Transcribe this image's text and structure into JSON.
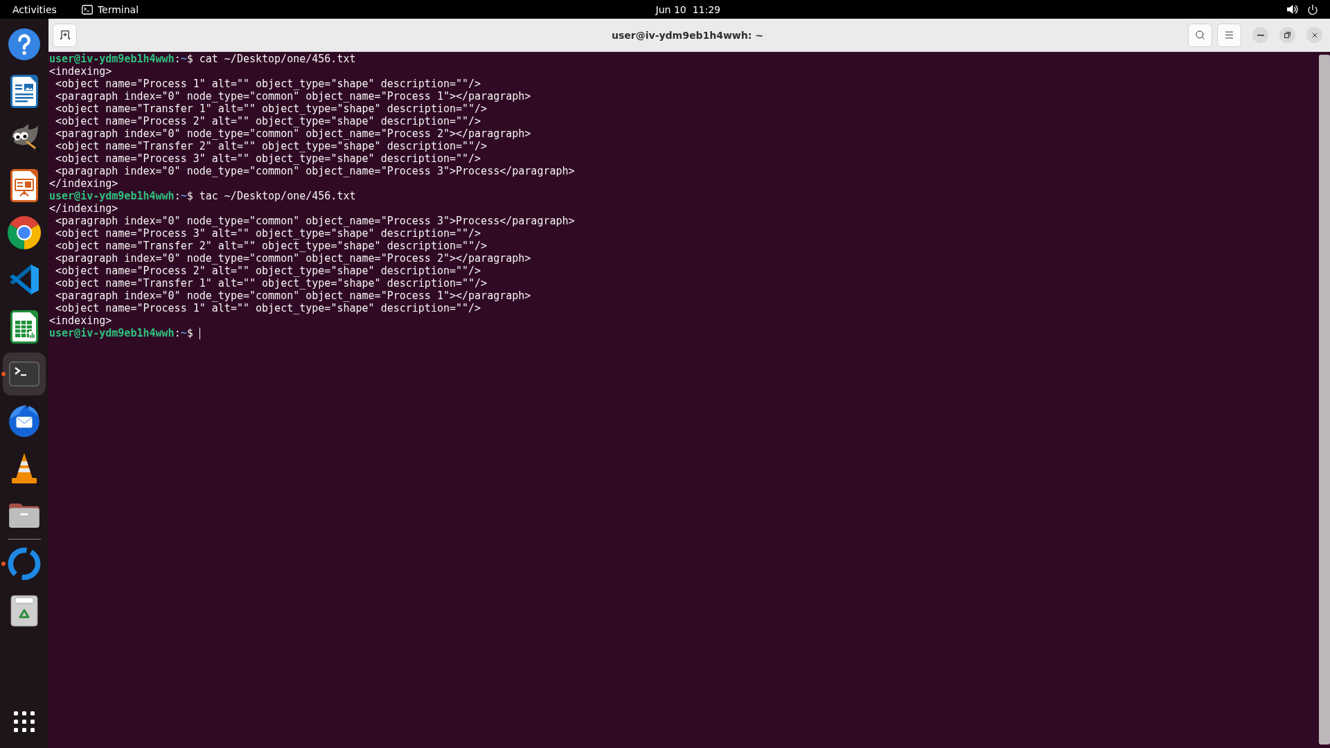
{
  "top_bar": {
    "activities": "Activities",
    "app_name": "Terminal",
    "clock": "Jun 10  11:29"
  },
  "dock": {
    "pinned": [
      {
        "running": false,
        "selected": false
      },
      {
        "running": false,
        "selected": false
      },
      {
        "running": false,
        "selected": false
      },
      {
        "running": false,
        "selected": false
      },
      {
        "running": false,
        "selected": false
      },
      {
        "running": false,
        "selected": false
      },
      {
        "running": false,
        "selected": false
      },
      {
        "running": true,
        "selected": true
      },
      {
        "running": false,
        "selected": false
      },
      {
        "running": false,
        "selected": false
      },
      {
        "running": false,
        "selected": false
      }
    ],
    "others": [
      {
        "running": true,
        "selected": false
      },
      {
        "running": false,
        "selected": false
      }
    ]
  },
  "window": {
    "title": "user@iv-ydm9eb1h4wwh: ~"
  },
  "terminal": {
    "lines": [
      {
        "kind": "prompt",
        "user_host": "user@iv-ydm9eb1h4wwh",
        "separator": ":",
        "path": "~",
        "symbol": "$",
        "command": "cat ~/Desktop/one/456.txt",
        "cursor": false
      },
      {
        "kind": "output",
        "text": "<indexing>"
      },
      {
        "kind": "output",
        "text": " <object name=\"Process 1\" alt=\"\" object_type=\"shape\" description=\"\"/>"
      },
      {
        "kind": "output",
        "text": " <paragraph index=\"0\" node_type=\"common\" object_name=\"Process 1\"></paragraph>"
      },
      {
        "kind": "output",
        "text": " <object name=\"Transfer 1\" alt=\"\" object_type=\"shape\" description=\"\"/>"
      },
      {
        "kind": "output",
        "text": " <object name=\"Process 2\" alt=\"\" object_type=\"shape\" description=\"\"/>"
      },
      {
        "kind": "output",
        "text": " <paragraph index=\"0\" node_type=\"common\" object_name=\"Process 2\"></paragraph>"
      },
      {
        "kind": "output",
        "text": " <object name=\"Transfer 2\" alt=\"\" object_type=\"shape\" description=\"\"/>"
      },
      {
        "kind": "output",
        "text": " <object name=\"Process 3\" alt=\"\" object_type=\"shape\" description=\"\"/>"
      },
      {
        "kind": "output",
        "text": " <paragraph index=\"0\" node_type=\"common\" object_name=\"Process 3\">Process</paragraph>"
      },
      {
        "kind": "output",
        "text": "</indexing>"
      },
      {
        "kind": "prompt",
        "user_host": "user@iv-ydm9eb1h4wwh",
        "separator": ":",
        "path": "~",
        "symbol": "$",
        "command": "tac ~/Desktop/one/456.txt",
        "cursor": false
      },
      {
        "kind": "output",
        "text": "</indexing>"
      },
      {
        "kind": "output",
        "text": " <paragraph index=\"0\" node_type=\"common\" object_name=\"Process 3\">Process</paragraph>"
      },
      {
        "kind": "output",
        "text": " <object name=\"Process 3\" alt=\"\" object_type=\"shape\" description=\"\"/>"
      },
      {
        "kind": "output",
        "text": " <object name=\"Transfer 2\" alt=\"\" object_type=\"shape\" description=\"\"/>"
      },
      {
        "kind": "output",
        "text": " <paragraph index=\"0\" node_type=\"common\" object_name=\"Process 2\"></paragraph>"
      },
      {
        "kind": "output",
        "text": " <object name=\"Process 2\" alt=\"\" object_type=\"shape\" description=\"\"/>"
      },
      {
        "kind": "output",
        "text": " <object name=\"Transfer 1\" alt=\"\" object_type=\"shape\" description=\"\"/>"
      },
      {
        "kind": "output",
        "text": " <paragraph index=\"0\" node_type=\"common\" object_name=\"Process 1\"></paragraph>"
      },
      {
        "kind": "output",
        "text": " <object name=\"Process 1\" alt=\"\" object_type=\"shape\" description=\"\"/>"
      },
      {
        "kind": "output",
        "text": "<indexing>"
      },
      {
        "kind": "prompt",
        "user_host": "user@iv-ydm9eb1h4wwh",
        "separator": ":",
        "path": "~",
        "symbol": "$",
        "cursor": true
      }
    ]
  }
}
